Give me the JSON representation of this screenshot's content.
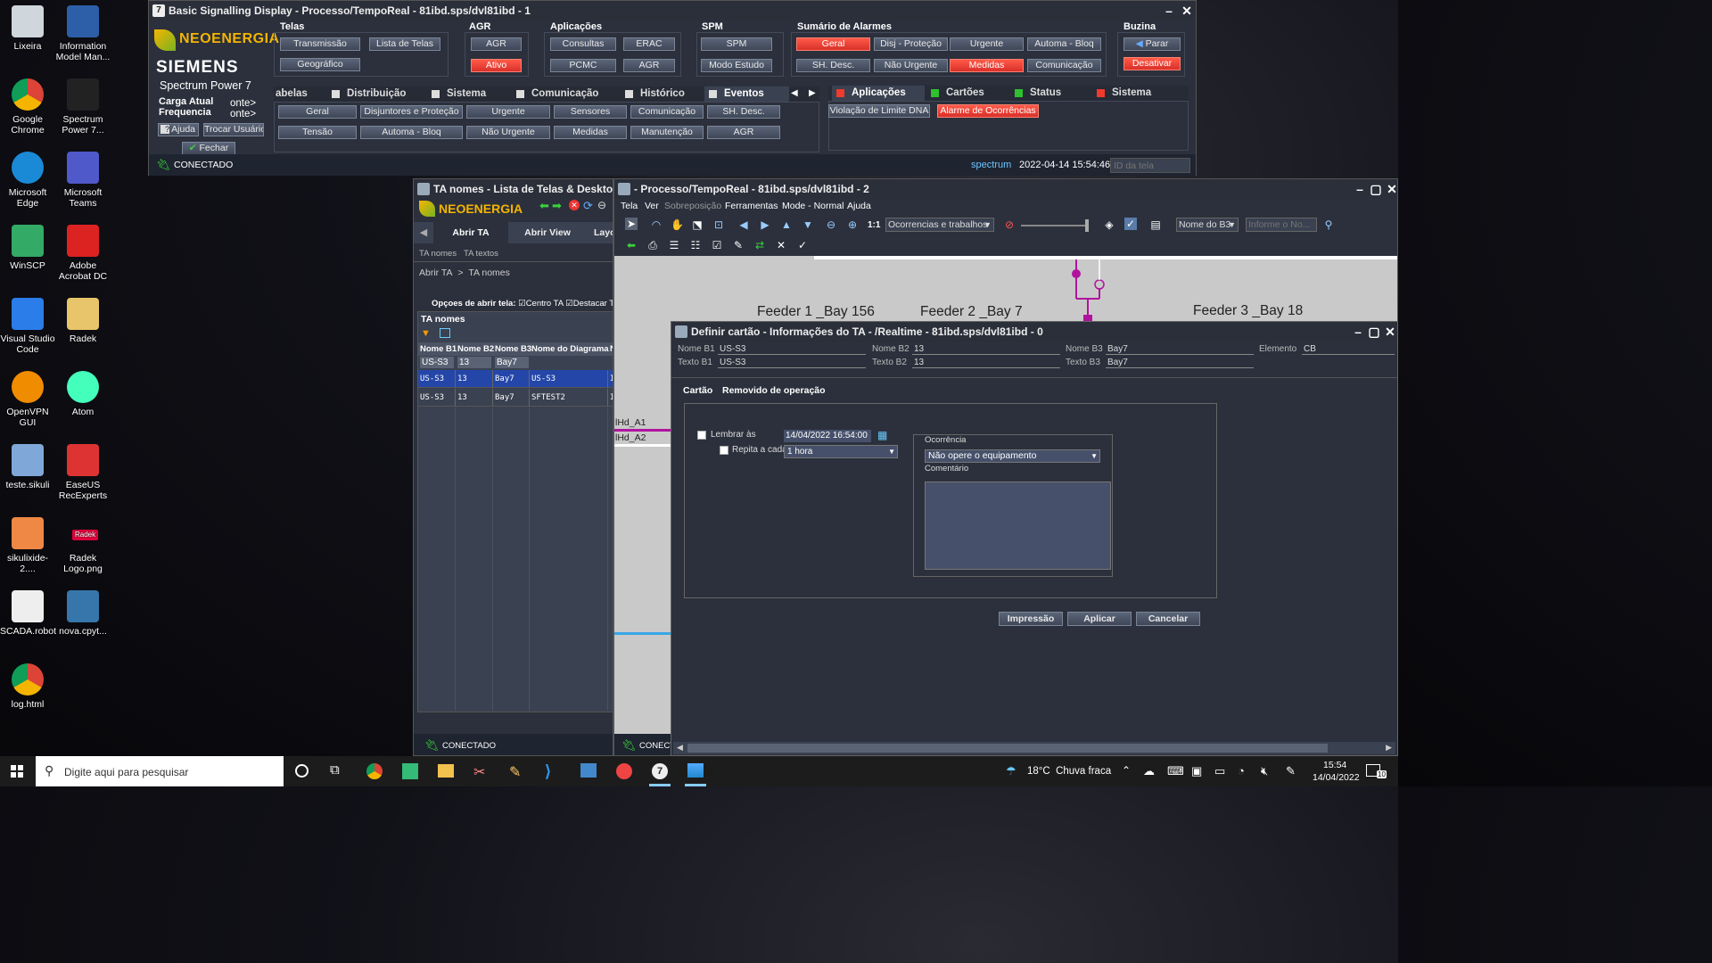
{
  "desktop": {
    "icons": [
      {
        "label": "Lixeira",
        "name": "recycle-bin-icon"
      },
      {
        "label": "Information Model Man...",
        "name": "information-model-manager-icon"
      },
      {
        "label": "Google Chrome",
        "name": "chrome-icon"
      },
      {
        "label": "Spectrum Power 7...",
        "name": "spectrum-power-icon"
      },
      {
        "label": "Microsoft Edge",
        "name": "edge-icon"
      },
      {
        "label": "Microsoft Teams",
        "name": "teams-icon"
      },
      {
        "label": "WinSCP",
        "name": "winscp-icon"
      },
      {
        "label": "Adobe Acrobat DC",
        "name": "acrobat-icon"
      },
      {
        "label": "Visual Studio Code",
        "name": "vscode-icon"
      },
      {
        "label": "Radek",
        "name": "folder-icon"
      },
      {
        "label": "OpenVPN GUI",
        "name": "openvpn-icon"
      },
      {
        "label": "Atom",
        "name": "atom-icon"
      },
      {
        "label": "teste.sikuli",
        "name": "sikuli-folder-icon"
      },
      {
        "label": "EaseUS RecExperts",
        "name": "easeus-icon"
      },
      {
        "label": "sikulixide-2....",
        "name": "java-icon"
      },
      {
        "label": "Radek Logo.png",
        "name": "image-file-icon"
      },
      {
        "label": "SCADA.robot",
        "name": "text-file-icon"
      },
      {
        "label": "nova.cpyt...",
        "name": "python-icon"
      },
      {
        "label": "log.html",
        "name": "chrome-html-icon"
      }
    ],
    "radek_logo_text": "Radek"
  },
  "bsd": {
    "title": "Basic Signalling Display - Processo/TempoReal - 81ibd.sps/dvl81ibd - 1",
    "brand": "NEOENERGIA",
    "siemens": "SIEMENS",
    "product": "Spectrum Power 7",
    "carga": "Carga Atual",
    "frequencia": "Frequencia",
    "carga_val": "onte>",
    "freq_val": "onte>",
    "ajuda": "Ajuda",
    "trocar": "Trocar Usuário",
    "fechar": "Fechar",
    "status": "CONECTADO",
    "user": "spectrum",
    "datetime": "2022-04-14 15:54:46",
    "id_placeholder": "ID da tela",
    "sections": {
      "telas": "Telas",
      "agr": "AGR",
      "aplicacoes": "Aplicações",
      "spm": "SPM",
      "alarmes": "Sumário de Alarmes",
      "buzina": "Buzina"
    },
    "telas_btns": [
      "Transmissão",
      "Lista de Telas",
      "Geográfico"
    ],
    "agr_btns": [
      "AGR",
      "Ativo"
    ],
    "apl_btns": [
      "Consultas",
      "ERAC",
      "PCMC",
      "AGR"
    ],
    "spm_btns": [
      "SPM",
      "Modo Estudo"
    ],
    "alarm_btns": [
      "Geral",
      "Disj - Proteção",
      "Urgente",
      "Automa - Bloq",
      "SH. Desc.",
      "Não Urgente",
      "Medidas",
      "Comunicação"
    ],
    "buzina_btns": [
      "Parar",
      "Desativar"
    ],
    "tabs_left": [
      "abelas",
      "Distribuição",
      "Sistema",
      "Comunicação",
      "Histórico",
      "Eventos"
    ],
    "event_btns": [
      "Geral",
      "Disjuntores e Proteção",
      "Urgente",
      "Sensores",
      "Comunicação",
      "SH. Desc.",
      "Tensão",
      "Automa - Bloq",
      "Não Urgente",
      "Medidas",
      "Manutenção",
      "AGR"
    ],
    "tabs_right": [
      "Aplicações",
      "Cartões",
      "Status",
      "Sistema"
    ],
    "app_btns": [
      "Violação de Limite DNA",
      "Alarme de Ocorrências"
    ]
  },
  "ta": {
    "title": "TA nomes - Lista de Telas & Desktop layo",
    "brand": "NEOENERGIA",
    "tabs": [
      "Abrir TA",
      "Abrir View",
      "Layo"
    ],
    "subtabs": [
      "TA nomes",
      "TA textos"
    ],
    "breadcrumb": [
      "Abrir TA",
      ">",
      "TA nomes"
    ],
    "options_label": "Opçoes de abrir tela:",
    "opt1": "Centro TA",
    "opt2": "Destacar T",
    "panel_title": "TA nomes",
    "columns": [
      "Nome B1",
      "Nome B2",
      "Nome B3",
      "Nome do Diagrama",
      "N"
    ],
    "filters": [
      "US-S3",
      "13",
      "Bay7"
    ],
    "rows": [
      [
        "US-S3",
        "13",
        "Bay7",
        "US-S3",
        "I"
      ],
      [
        "US-S3",
        "13",
        "Bay7",
        "SFTEST2",
        "I"
      ]
    ],
    "status": "CONECTADO"
  },
  "proc": {
    "title": "- Processo/TempoReal - 81ibd.sps/dvl81ibd - 2",
    "menu": [
      "Tela",
      "Ver",
      "Sobreposição",
      "Ferramentas",
      "Mode - Normal",
      "Ajuda"
    ],
    "zoom": "1:1",
    "layer_select": "Ocorrencias e trabalhos",
    "name_select": "Nome do B3",
    "info_placeholder": "Informe o No...",
    "feeders": [
      "Feeder 1 _Bay 156",
      "Feeder 2 _Bay 7",
      "Feeder 3 _Bay 18"
    ],
    "lines": [
      "lHd_A1",
      "lHd_A2"
    ],
    "status": "CONECT"
  },
  "dialog": {
    "title": "Definir cartão - Informações do TA - /Realtime - 81ibd.sps/dvl81ibd - 0",
    "labels": {
      "nb1": "Nome B1",
      "nb2": "Nome B2",
      "nb3": "Nome B3",
      "elem": "Elemento",
      "tb1": "Texto B1",
      "tb2": "Texto B2",
      "tb3": "Texto B3"
    },
    "values": {
      "nb1": "US-S3",
      "nb2": "13",
      "nb3": "Bay7",
      "elem": "CB",
      "tb1": "US-S3",
      "tb2": "13",
      "tb3": "Bay7"
    },
    "card_label": "Cartão",
    "card_value": "Removido de operação",
    "lembrar": "Lembrar às",
    "lembrar_value": "14/04/2022 16:54:00",
    "repita": "Repita a cada",
    "repita_value": "1 hora",
    "ocorrencia_title": "Ocorrência",
    "ocorrencia_value": "Não opere o equipamento",
    "comentario": "Comentário",
    "buttons": [
      "Impressão",
      "Aplicar",
      "Cancelar"
    ]
  },
  "taskbar": {
    "search_placeholder": "Digite aqui para pesquisar",
    "weather": "18°C  Chuva fraca",
    "time": "15:54",
    "date": "14/04/2022",
    "notif": "10"
  },
  "colors": {
    "accent_red": "#f03a2c",
    "bg_dark": "#2b303c",
    "brand_yellow": "#f4b400",
    "conn_green": "#3cd23c",
    "magenta": "#b0149e"
  }
}
